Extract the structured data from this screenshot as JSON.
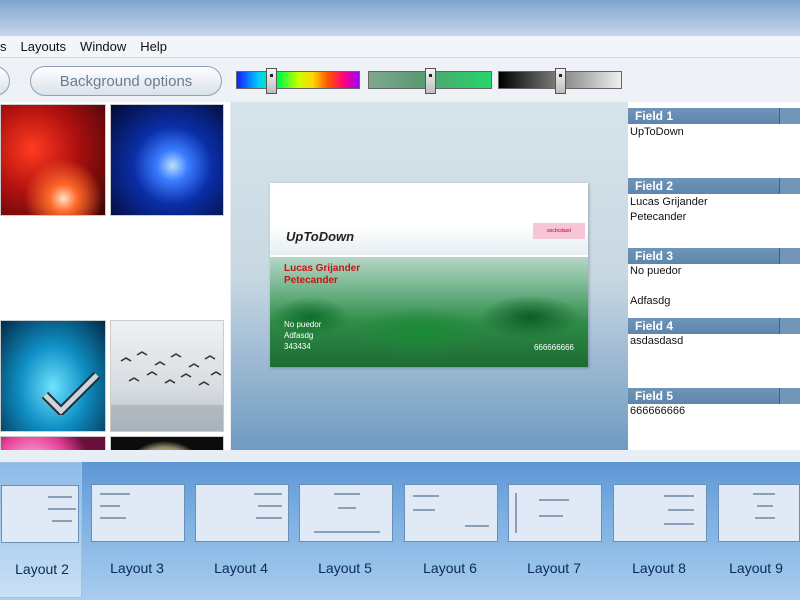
{
  "menu": {
    "items": [
      "s",
      "Layouts",
      "Window",
      "Help"
    ]
  },
  "toolbar": {
    "background_options_label": "Background options",
    "sliders": [
      {
        "name": "hue",
        "value_fraction": 0.28
      },
      {
        "name": "green-tint",
        "value_fraction": 0.5
      },
      {
        "name": "brightness",
        "value_fraction": 0.5
      }
    ]
  },
  "gallery": {
    "images": [
      "red-fireworks",
      "blue-fireworks",
      "coral-reef-checkmark",
      "flying-birds",
      "pink-flowers",
      "white-rose"
    ]
  },
  "preview": {
    "card": {
      "title": "UpToDown",
      "badge": "ascbcdasd",
      "name_line1": "Lucas Grijander",
      "name_line2": "Petecander",
      "detail_line1": "No puedor",
      "detail_line2": "Adfasdg",
      "detail_line3": "343434",
      "phone": "666666666"
    }
  },
  "fields": [
    {
      "label": "Field 1",
      "lines": [
        "UpToDown"
      ]
    },
    {
      "label": "Field 2",
      "lines": [
        "Lucas Grijander",
        "Petecander"
      ]
    },
    {
      "label": "Field 3",
      "lines": [
        "No puedor",
        "",
        "Adfasdg"
      ]
    },
    {
      "label": "Field 4",
      "lines": [
        "asdasdasd"
      ]
    },
    {
      "label": "Field 5",
      "lines": [
        "666666666"
      ]
    }
  ],
  "layouts": {
    "items": [
      "Layout 2",
      "Layout 3",
      "Layout 4",
      "Layout 5",
      "Layout 6",
      "Layout 7",
      "Layout 8",
      "Layout 9"
    ],
    "selected": "Layout 2"
  },
  "colors": {
    "accent": "#5e97d6",
    "field_header": "#7396b8",
    "card_name": "#c81414"
  }
}
